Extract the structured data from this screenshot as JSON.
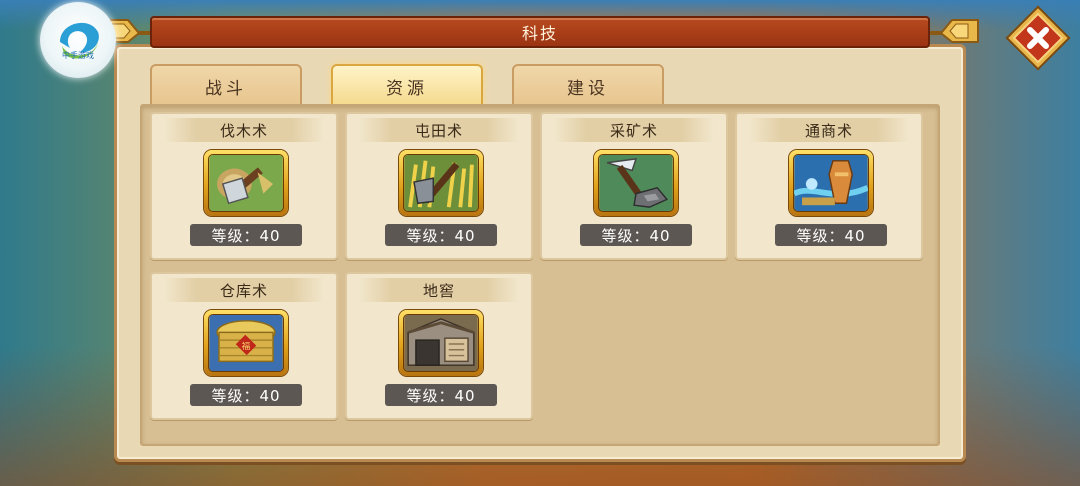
{
  "window": {
    "title": "科技"
  },
  "logo": {
    "text": "中手游戏"
  },
  "tabs": [
    {
      "label": "战斗",
      "active": false
    },
    {
      "label": "资源",
      "active": true
    },
    {
      "label": "建设",
      "active": false
    }
  ],
  "techs": [
    {
      "name": "伐木术",
      "level": "等级：40",
      "icon": "lumber-axe-icon"
    },
    {
      "name": "屯田术",
      "level": "等级：40",
      "icon": "farming-hoe-icon"
    },
    {
      "name": "采矿术",
      "level": "等级：40",
      "icon": "mining-pickaxe-icon"
    },
    {
      "name": "通商术",
      "level": "等级：40",
      "icon": "trade-goods-icon"
    },
    {
      "name": "仓库术",
      "level": "等级：40",
      "icon": "granary-icon"
    },
    {
      "name": "地窖",
      "level": "等级：40",
      "icon": "cellar-icon"
    }
  ],
  "colors": {
    "title_bar": "#a83c17",
    "panel": "#e9d8b4",
    "icon_frame": "#e1a21c",
    "level_badge": "#5c5752",
    "close_button": "#c2361c"
  }
}
